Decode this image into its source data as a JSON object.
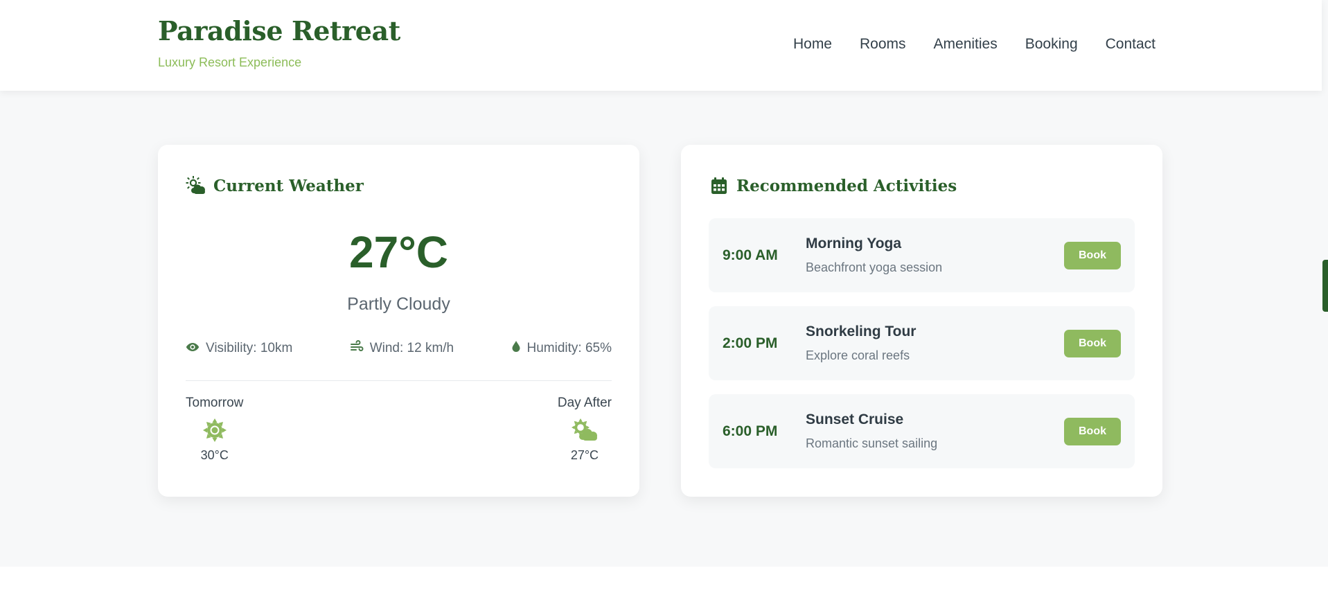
{
  "brand": {
    "title": "Paradise Retreat",
    "tagline": "Luxury Resort Experience"
  },
  "nav": [
    "Home",
    "Rooms",
    "Amenities",
    "Booking",
    "Contact"
  ],
  "weather": {
    "title": "Current Weather",
    "title_icon": "cloud-sun-icon",
    "temperature": "27°C",
    "condition": "Partly Cloudy",
    "stats": [
      {
        "icon": "eye-icon",
        "text": "Visibility: 10km"
      },
      {
        "icon": "wind-icon",
        "text": "Wind: 12 km/h"
      },
      {
        "icon": "droplet-icon",
        "text": "Humidity: 65%"
      }
    ],
    "forecast": [
      {
        "day": "Tomorrow",
        "icon": "sun-icon",
        "temp": "30°C"
      },
      {
        "day": "Day After",
        "icon": "cloud-sun-icon",
        "temp": "27°C"
      }
    ]
  },
  "activities": {
    "title": "Recommended Activities",
    "title_icon": "calendar-icon",
    "items": [
      {
        "time": "9:00 AM",
        "name": "Morning Yoga",
        "description": "Beachfront yoga session",
        "button": "Book"
      },
      {
        "time": "2:00 PM",
        "name": "Snorkeling Tour",
        "description": "Explore coral reefs",
        "button": "Book"
      },
      {
        "time": "6:00 PM",
        "name": "Sunset Cruise",
        "description": "Romantic sunset sailing",
        "button": "Book"
      }
    ]
  },
  "colors": {
    "primary": "#2a5f2a",
    "accent": "#8fba5f",
    "background": "#f7f8f9"
  }
}
